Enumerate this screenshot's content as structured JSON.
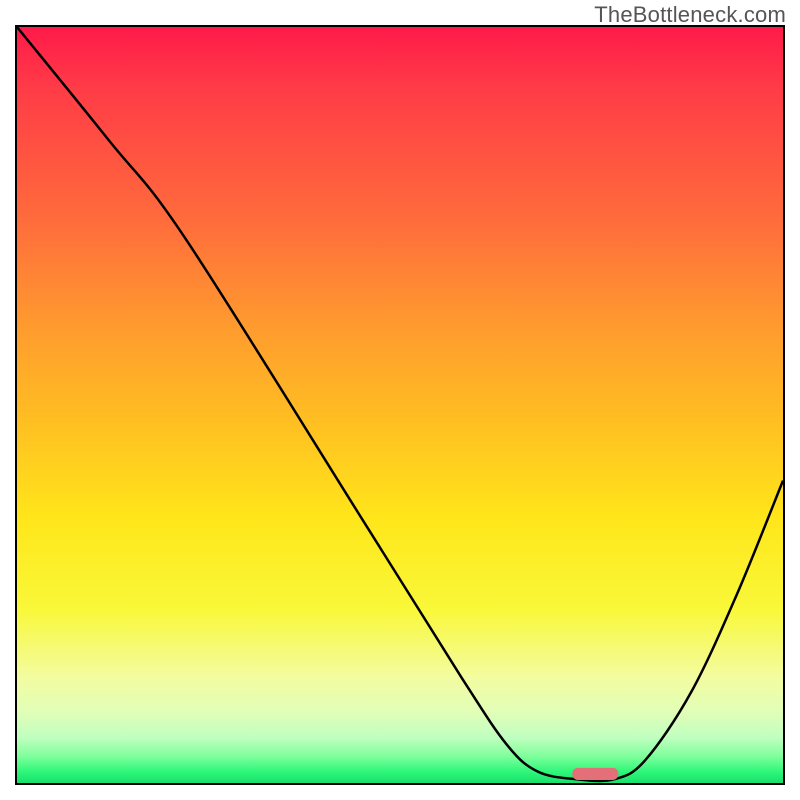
{
  "watermark": "TheBottleneck.com",
  "chart_data": {
    "type": "line",
    "title": "",
    "xlabel": "",
    "ylabel": "",
    "xlim": [
      0,
      100
    ],
    "ylim": [
      0,
      100
    ],
    "grid": false,
    "series": [
      {
        "name": "bottleneck-curve",
        "x": [
          0,
          12,
          22,
          45,
          58,
          64,
          68,
          73,
          78,
          82,
          88,
          94,
          100
        ],
        "y": [
          100,
          85,
          72,
          35,
          14,
          5,
          1.5,
          0.5,
          0.5,
          3,
          12,
          25,
          40
        ]
      }
    ],
    "marker": {
      "name": "optimal-zone",
      "x_center": 75.5,
      "y": 1,
      "width": 6,
      "color": "#e37078"
    },
    "background_gradient_stops": [
      {
        "pos": 0.0,
        "color": "#ff1a49"
      },
      {
        "pos": 0.25,
        "color": "#ff6a3c"
      },
      {
        "pos": 0.52,
        "color": "#ffbe22"
      },
      {
        "pos": 0.77,
        "color": "#f9f839"
      },
      {
        "pos": 0.94,
        "color": "#c0ffc0"
      },
      {
        "pos": 1.0,
        "color": "#18e06c"
      }
    ]
  }
}
